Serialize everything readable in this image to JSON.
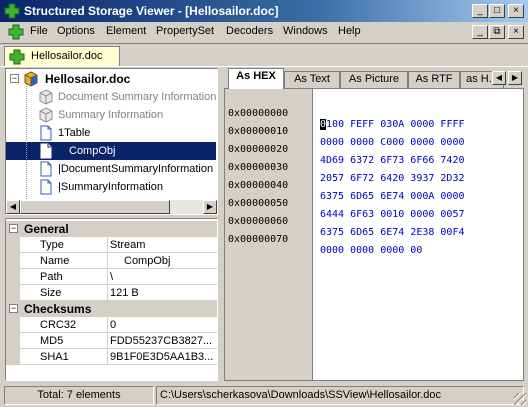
{
  "window": {
    "title": "Structured Storage Viewer - [Hellosailor.doc]",
    "caption_buttons": [
      "_",
      "□",
      "×"
    ],
    "mdi_buttons": [
      "_",
      "⧉",
      "×"
    ]
  },
  "menu": {
    "items": [
      "File",
      "Options",
      "Element",
      "PropertySet",
      "Decoders",
      "Windows",
      "Help"
    ]
  },
  "document_tab": {
    "label": "Hellosailor.doc"
  },
  "tree": {
    "root": "Hellosailor.doc",
    "items": [
      {
        "label": "Document Summary Information",
        "icon": "propertyset-icon",
        "dim": true
      },
      {
        "label": "Summary Information",
        "icon": "propertyset-icon",
        "dim": true
      },
      {
        "label": "1Table",
        "icon": "stream-icon",
        "dim": false
      },
      {
        "label": "CompObj",
        "icon": "stream-icon",
        "dim": false,
        "selected": true
      },
      {
        "label": "|DocumentSummaryInformation",
        "icon": "stream-icon",
        "dim": false
      },
      {
        "label": "|SummaryInformation",
        "icon": "stream-icon",
        "dim": false
      }
    ]
  },
  "properties": {
    "general_label": "General",
    "general": [
      {
        "key": "Type",
        "value": "Stream"
      },
      {
        "key": "Name",
        "value": "CompObj"
      },
      {
        "key": "Path",
        "value": "\\"
      },
      {
        "key": "Size",
        "value": "121 B"
      }
    ],
    "checksums_label": "Checksums",
    "checksums": [
      {
        "key": "CRC32",
        "value": "0"
      },
      {
        "key": "MD5",
        "value": "FDD55237CB3827..."
      },
      {
        "key": "SHA1",
        "value": "9B1F0E3D5AA1B3..."
      }
    ]
  },
  "view_tabs": [
    "As HEX",
    "As Text",
    "As Picture",
    "As RTF",
    "as H..."
  ],
  "hex": {
    "rows": [
      {
        "address": "0x00000000",
        "cursor": "0",
        "data": "100 FEFF 030A 0000 FFFF"
      },
      {
        "address": "0x00000010",
        "cursor": "",
        "data": "0000 0000 C000 0000 0000"
      },
      {
        "address": "0x00000020",
        "cursor": "",
        "data": "4D69 6372 6F73 6F66 7420"
      },
      {
        "address": "0x00000030",
        "cursor": "",
        "data": "2057 6F72 6420 3937 2D32"
      },
      {
        "address": "0x00000040",
        "cursor": "",
        "data": "6375 6D65 6E74 000A 0000"
      },
      {
        "address": "0x00000050",
        "cursor": "",
        "data": "6444 6F63 0010 0000 0057"
      },
      {
        "address": "0x00000060",
        "cursor": "",
        "data": "6375 6D65 6E74 2E38 00F4"
      },
      {
        "address": "0x00000070",
        "cursor": "",
        "data": "0000 0000 0000 00"
      }
    ]
  },
  "status": {
    "count": "Total: 7 elements",
    "path": "C:\\Users\\scherkasova\\Downloads\\SSView\\Hellosailor.doc"
  },
  "colors": {
    "selection": "#0a246a",
    "hex_digits": "#0000c8",
    "tab_highlight": "#ffffd0"
  }
}
